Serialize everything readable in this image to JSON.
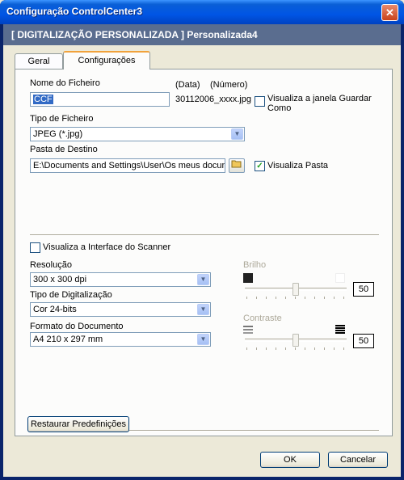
{
  "window": {
    "title": "Configuração ControlCenter3",
    "close_glyph": "✕"
  },
  "header": {
    "text": "[  DIGITALIZAÇÃO PERSONALIZADA  ]    Personalizada4"
  },
  "tabs": [
    {
      "label": "Geral"
    },
    {
      "label": "Configurações",
      "active": true
    }
  ],
  "file_name": {
    "label": "Nome do Ficheiro",
    "value": "CCF",
    "date_label": "(Data)",
    "number_label": "(Número)",
    "pattern": "30112006_xxxx.jpg",
    "save_as_checkbox": {
      "label": "Visualiza a janela Guardar Como",
      "checked": false
    }
  },
  "file_type": {
    "label": "Tipo de Ficheiro",
    "value": "JPEG (*.jpg)"
  },
  "destination": {
    "label": "Pasta de Destino",
    "value": "E:\\Documents and Settings\\User\\Os meus document",
    "show_folder_checkbox": {
      "label": "Visualiza Pasta",
      "checked": true
    },
    "browse_icon": "folder-icon"
  },
  "scanner_interface": {
    "label": "Visualiza a Interface do Scanner",
    "checked": false
  },
  "resolution": {
    "label": "Resolução",
    "value": "300 x 300 dpi"
  },
  "scan_type": {
    "label": "Tipo de Digitalização",
    "value": "Cor 24-bits"
  },
  "document_size": {
    "label": "Formato do Documento",
    "value": "A4 210 x 297 mm"
  },
  "brightness": {
    "label": "Brilho",
    "value": "50",
    "level": 0.5,
    "enabled": false
  },
  "contrast": {
    "label": "Contraste",
    "value": "50",
    "level": 0.5,
    "enabled": false
  },
  "restore_defaults_label": "Restaurar Predefinições",
  "ok_label": "OK",
  "cancel_label": "Cancelar",
  "colors": {
    "title_bar": "#0055e5",
    "header_bar": "#5a6d8f",
    "tab_accent": "#f1a23b",
    "selection": "#316ac5"
  }
}
